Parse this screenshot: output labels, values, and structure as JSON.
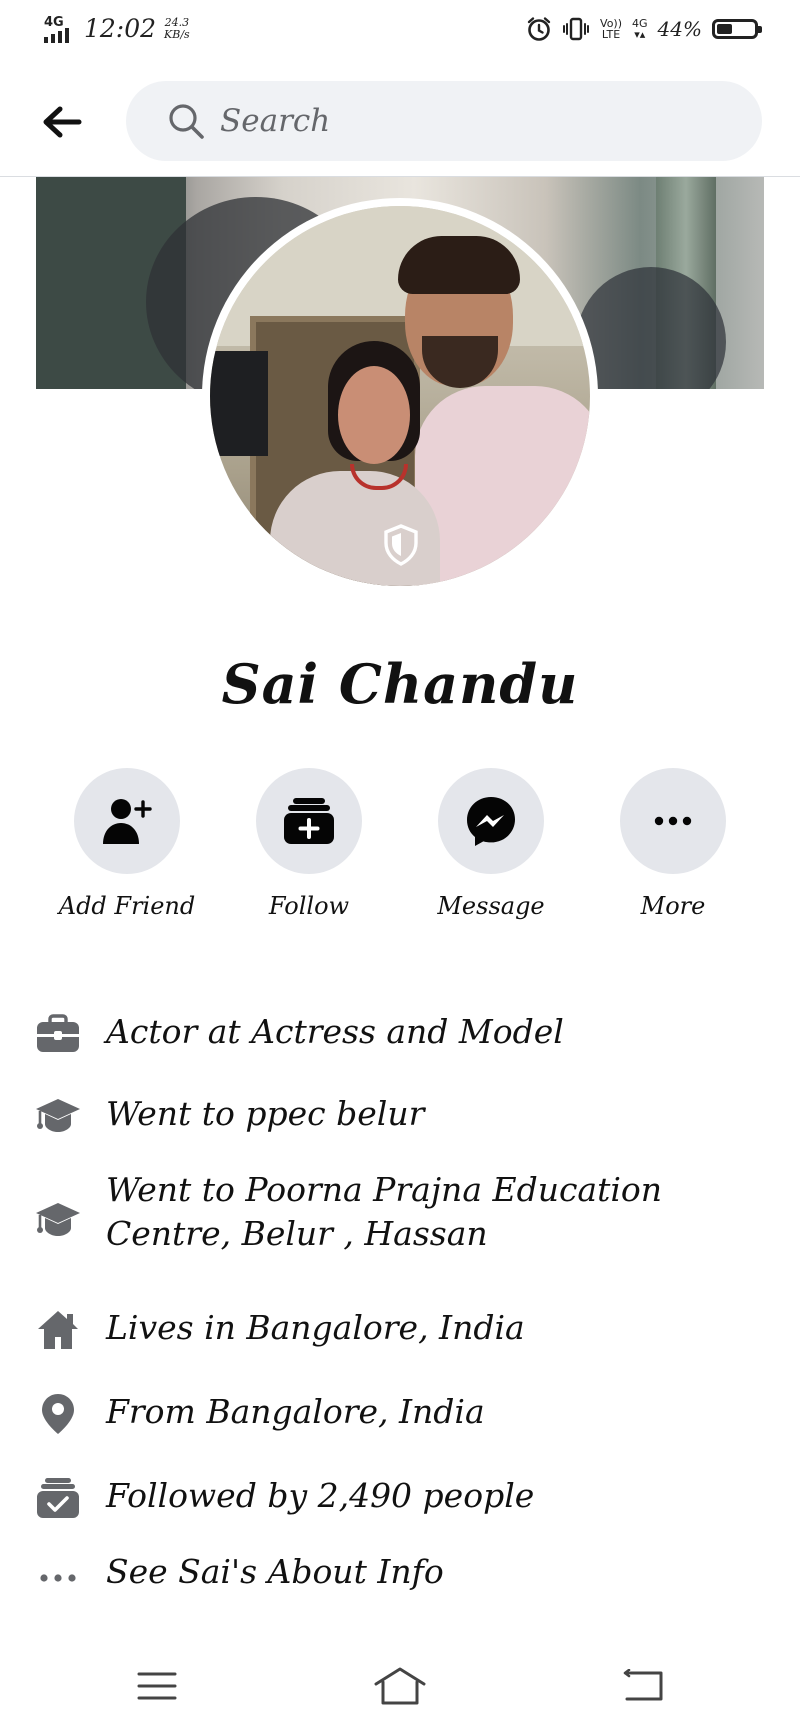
{
  "status_bar": {
    "network": "4G",
    "time": "12:02",
    "speed_value": "24.3",
    "speed_unit": "KB/s",
    "volte_top": "Vo))",
    "volte_bottom": "LTE",
    "network2": "4G",
    "battery": "44%",
    "icons": [
      "alarm-icon",
      "vibrate-icon",
      "volte-icon",
      "signal-4g-icon",
      "battery-icon"
    ]
  },
  "header": {
    "back_icon": "back-arrow-icon",
    "search_placeholder": "Search",
    "search_icon": "search-icon"
  },
  "profile": {
    "name": "Sai Chandu",
    "badge_icon": "profile-shield-icon"
  },
  "actions": [
    {
      "label": "Add Friend",
      "icon": "add-friend-icon"
    },
    {
      "label": "Follow",
      "icon": "follow-icon"
    },
    {
      "label": "Message",
      "icon": "messenger-icon"
    },
    {
      "label": "More",
      "icon": "more-icon"
    }
  ],
  "details": [
    {
      "text": "Actor at Actress and Model",
      "icon": "briefcase-icon"
    },
    {
      "text": "Went to ppec belur",
      "icon": "graduation-cap-icon"
    },
    {
      "text_line1": "Went to Poorna Prajna Education",
      "text_line2": "Centre, Belur , Hassan",
      "icon": "graduation-cap-icon"
    },
    {
      "text": "Lives in Bangalore, India",
      "icon": "home-icon"
    },
    {
      "text": "From Bangalore, India",
      "icon": "location-pin-icon"
    },
    {
      "text": "Followed by 2,490 people",
      "icon": "followers-icon"
    },
    {
      "text": "See Sai's About Info",
      "icon": "more-dots-icon"
    }
  ],
  "nav": {
    "icons": [
      "menu-icon",
      "home-nav-icon",
      "back-nav-icon"
    ]
  },
  "colors": {
    "icon_gray": "#65676b",
    "circle_bg": "#e4e6eb",
    "search_bg": "#f0f2f5"
  }
}
